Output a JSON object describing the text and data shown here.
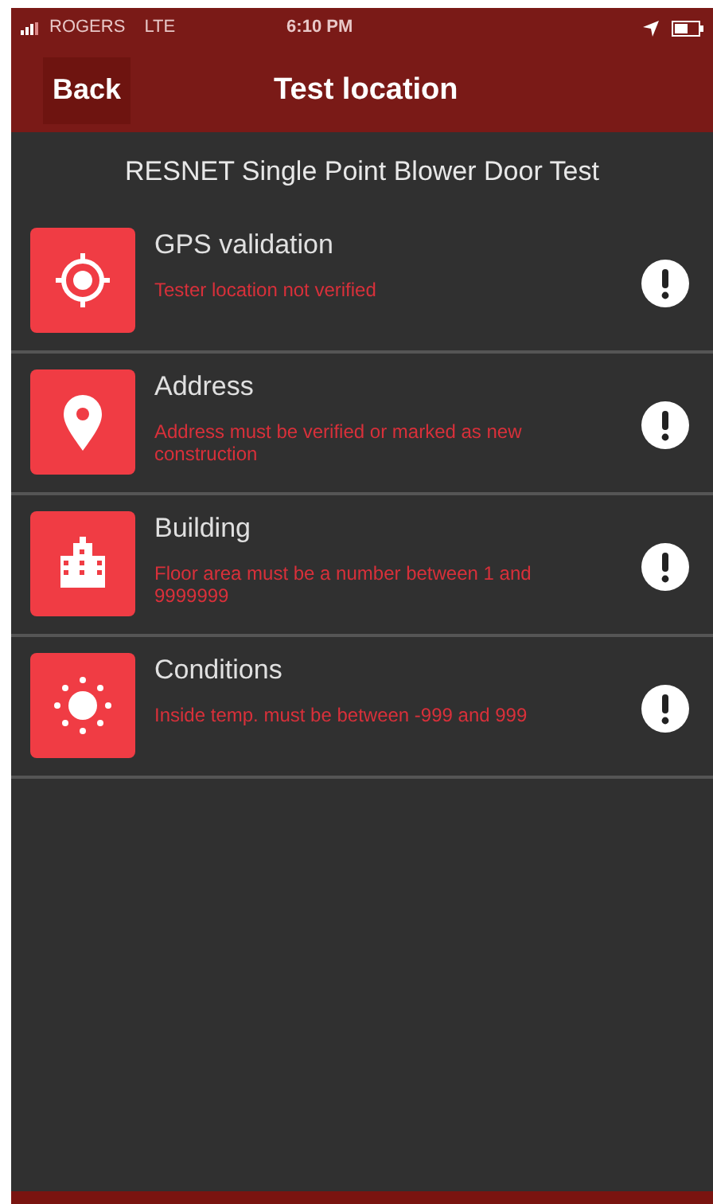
{
  "status_bar": {
    "carrier": "ROGERS",
    "network": "LTE",
    "time": "6:10 PM"
  },
  "nav": {
    "back": "Back",
    "title": "Test location"
  },
  "subtitle": "RESNET Single Point Blower Door Test",
  "items": [
    {
      "kind": "target",
      "title": "GPS validation",
      "message": "Tester location not verified"
    },
    {
      "kind": "pin",
      "title": "Address",
      "message": "Address must be verified or marked as new construction"
    },
    {
      "kind": "building",
      "title": "Building",
      "message": "Floor area must be a number between 1 and 9999999"
    },
    {
      "kind": "sun",
      "title": "Conditions",
      "message": "Inside temp. must be between -999 and 999"
    }
  ]
}
